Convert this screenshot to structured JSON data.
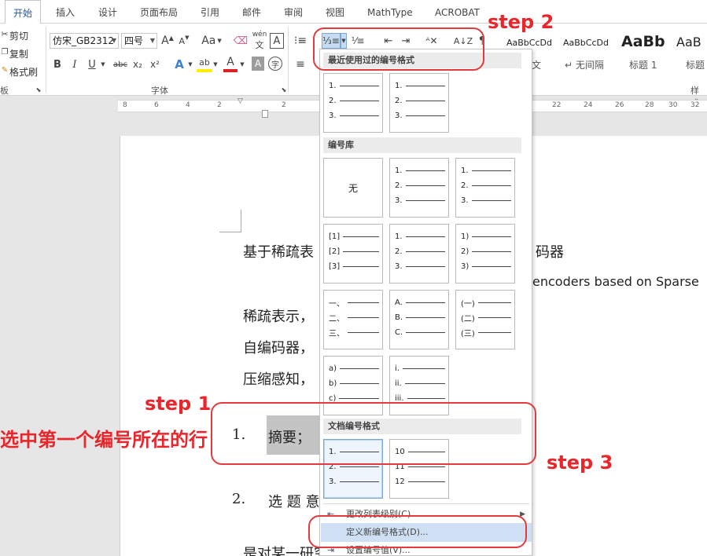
{
  "tabs": [
    {
      "label": "开始",
      "active": true
    },
    {
      "label": "插入"
    },
    {
      "label": "设计"
    },
    {
      "label": "页面布局"
    },
    {
      "label": "引用"
    },
    {
      "label": "邮件"
    },
    {
      "label": "审阅"
    },
    {
      "label": "视图"
    },
    {
      "label": "MathType"
    },
    {
      "label": "ACROBAT"
    }
  ],
  "clipboard": {
    "cut": "剪切",
    "copy": "复制",
    "format_painter": "格式刷",
    "group": "板"
  },
  "font": {
    "name": "仿宋_GB2312",
    "size": "四号",
    "group": "字体",
    "grow_glyph": "A",
    "shrink_glyph": "A",
    "case_glyph": "Aa",
    "phonetic_glyph": "wén",
    "border_glyph": "A",
    "bold": "B",
    "italic": "I",
    "underline": "U",
    "strike": "abc",
    "subscript": "x₂",
    "superscript": "x²",
    "effects": "A",
    "highlight": "ab",
    "color": "A",
    "shading": "A",
    "enclose": "字"
  },
  "styles": {
    "group": "样式",
    "items": [
      {
        "sample": "AaBbCcDd",
        "name": "文"
      },
      {
        "sample": "AaBbCcDd",
        "name": "↵ 无间隔"
      },
      {
        "sample": "AaBb",
        "name": "标题 1"
      },
      {
        "sample": "AaB",
        "name": "标题"
      }
    ]
  },
  "ruler": {
    "numbers": [
      "8",
      "6",
      "4",
      "2",
      "2",
      "22",
      "24",
      "26",
      "28",
      "30",
      "32"
    ]
  },
  "document": {
    "lines": [
      "基于稀疏表",
      "码器",
      "encoders based on Sparse",
      "稀疏表示，",
      "自编码器，",
      "压缩感知，",
      "1.",
      "摘要；",
      "2.",
      "选 题 意",
      "是对某一研究"
    ]
  },
  "dropdown": {
    "recent_header": "最近使用过的编号格式",
    "library_header": "编号库",
    "document_header": "文档编号格式",
    "none_label": "无",
    "recent": [
      [
        "1.",
        "2.",
        "3."
      ],
      [
        "1.",
        "2.",
        "3."
      ]
    ],
    "library": [
      [
        "1.",
        "2.",
        "3."
      ],
      [
        "1.",
        "2.",
        "3."
      ],
      [
        "[1]",
        "[2]",
        "[3]"
      ],
      [
        "1.",
        "2.",
        "3."
      ],
      [
        "1)",
        "2)",
        "3)"
      ],
      [
        "一、",
        "二、",
        "三、"
      ],
      [
        "A.",
        "B.",
        "C."
      ],
      [
        "(一)",
        "(二)",
        "(三)"
      ],
      [
        "a)",
        "b)",
        "c)"
      ],
      [
        "i.",
        "ii.",
        "iii."
      ]
    ],
    "document_formats": [
      [
        "1.",
        "2.",
        "3."
      ],
      [
        "10",
        "11",
        "12"
      ]
    ],
    "menu": [
      {
        "label": "更改列表级别(C)",
        "icon": "⇤",
        "submenu": true
      },
      {
        "label": "定义新编号格式(D)...",
        "icon": ""
      },
      {
        "label": "设置编号值(V)...",
        "icon": "⇥"
      }
    ]
  },
  "annotations": {
    "step1": "step 1",
    "step2": "step 2",
    "step3": "step 3",
    "note": "选中第一个编号所在的行",
    "color": "#e8262b"
  }
}
